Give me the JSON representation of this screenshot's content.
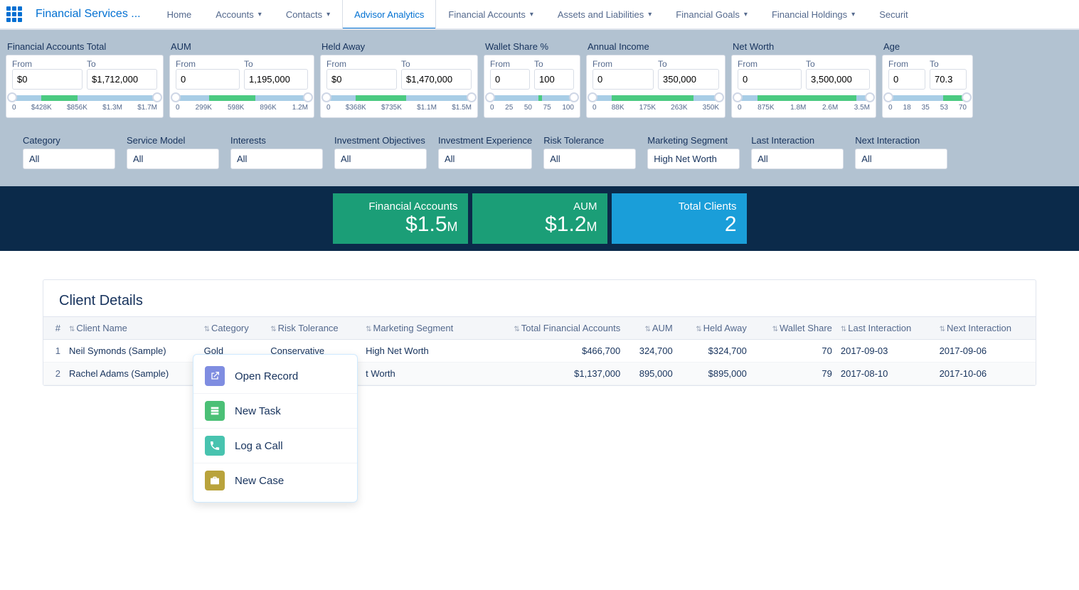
{
  "header": {
    "app_name": "Financial Services ...",
    "tabs": [
      {
        "label": "Home",
        "has_menu": false
      },
      {
        "label": "Accounts",
        "has_menu": true
      },
      {
        "label": "Contacts",
        "has_menu": true
      },
      {
        "label": "Advisor Analytics",
        "has_menu": false,
        "active": true
      },
      {
        "label": "Financial Accounts",
        "has_menu": true
      },
      {
        "label": "Assets and Liabilities",
        "has_menu": true
      },
      {
        "label": "Financial Goals",
        "has_menu": true
      },
      {
        "label": "Financial Holdings",
        "has_menu": true
      },
      {
        "label": "Securit",
        "has_menu": false
      }
    ]
  },
  "range_filters": [
    {
      "title": "Financial Accounts Total",
      "from": "$0",
      "to": "$1,712,000",
      "ticks": [
        "0",
        "$428K",
        "$856K",
        "$1.3M",
        "$1.7M"
      ],
      "fill_start": 20,
      "fill_end": 45
    },
    {
      "title": "AUM",
      "from": "0",
      "to": "1,195,000",
      "ticks": [
        "0",
        "299K",
        "598K",
        "896K",
        "1.2M"
      ],
      "fill_start": 25,
      "fill_end": 60
    },
    {
      "title": "Held Away",
      "from": "$0",
      "to": "$1,470,000",
      "ticks": [
        "0",
        "$368K",
        "$735K",
        "$1.1M",
        "$1.5M"
      ],
      "fill_start": 20,
      "fill_end": 55
    },
    {
      "title": "Wallet Share %",
      "from": "0",
      "to": "100",
      "ticks": [
        "0",
        "25",
        "50",
        "75",
        "100"
      ],
      "fill_start": 58,
      "fill_end": 62
    },
    {
      "title": "Annual Income",
      "from": "0",
      "to": "350,000",
      "ticks": [
        "0",
        "88K",
        "175K",
        "263K",
        "350K"
      ],
      "fill_start": 15,
      "fill_end": 80
    },
    {
      "title": "Net Worth",
      "from": "0",
      "to": "3,500,000",
      "ticks": [
        "0",
        "875K",
        "1.8M",
        "2.6M",
        "3.5M"
      ],
      "fill_start": 15,
      "fill_end": 90
    },
    {
      "title": "Age",
      "from": "0",
      "to": "70.3",
      "ticks": [
        "0",
        "18",
        "35",
        "53",
        "70"
      ],
      "fill_start": 70,
      "fill_end": 98
    }
  ],
  "dropdowns": [
    {
      "label": "Category",
      "value": "All"
    },
    {
      "label": "Service Model",
      "value": "All"
    },
    {
      "label": "Interests",
      "value": "All"
    },
    {
      "label": "Investment Objectives",
      "value": "All"
    },
    {
      "label": "Investment Experience",
      "value": "All"
    },
    {
      "label": "Risk Tolerance",
      "value": "All"
    },
    {
      "label": "Marketing Segment",
      "value": "High Net Worth"
    },
    {
      "label": "Last Interaction",
      "value": "All"
    },
    {
      "label": "Next Interaction",
      "value": "All"
    }
  ],
  "kpis": [
    {
      "label": "Financial Accounts",
      "value": "$1.5",
      "unit": "M",
      "color": "green"
    },
    {
      "label": "AUM",
      "value": "$1.2",
      "unit": "M",
      "color": "green"
    },
    {
      "label": "Total Clients",
      "value": "2",
      "unit": "",
      "color": "blue"
    }
  ],
  "table": {
    "title": "Client Details",
    "columns": [
      "#",
      "Client Name",
      "Category",
      "Risk Tolerance",
      "Marketing Segment",
      "Total Financial Accounts",
      "AUM",
      "Held Away",
      "Wallet Share",
      "Last Interaction",
      "Next Interaction"
    ],
    "rows": [
      {
        "idx": "1",
        "name": "Neil Symonds (Sample)",
        "category": "Gold",
        "risk": "Conservative",
        "segment": "High Net Worth",
        "total": "$466,700",
        "aum": "324,700",
        "held": "$324,700",
        "wallet": "70",
        "last": "2017-09-03",
        "next": "2017-09-06"
      },
      {
        "idx": "2",
        "name": "Rachel Adams (Sample)",
        "category": "",
        "risk": "",
        "segment": "t Worth",
        "total": "$1,137,000",
        "aum": "895,000",
        "held": "$895,000",
        "wallet": "79",
        "last": "2017-08-10",
        "next": "2017-10-06"
      }
    ]
  },
  "context_menu": {
    "items": [
      {
        "label": "Open Record",
        "icon": "open"
      },
      {
        "label": "New Task",
        "icon": "task"
      },
      {
        "label": "Log a Call",
        "icon": "call"
      },
      {
        "label": "New Case",
        "icon": "case"
      }
    ]
  },
  "labels": {
    "from": "From",
    "to": "To"
  }
}
